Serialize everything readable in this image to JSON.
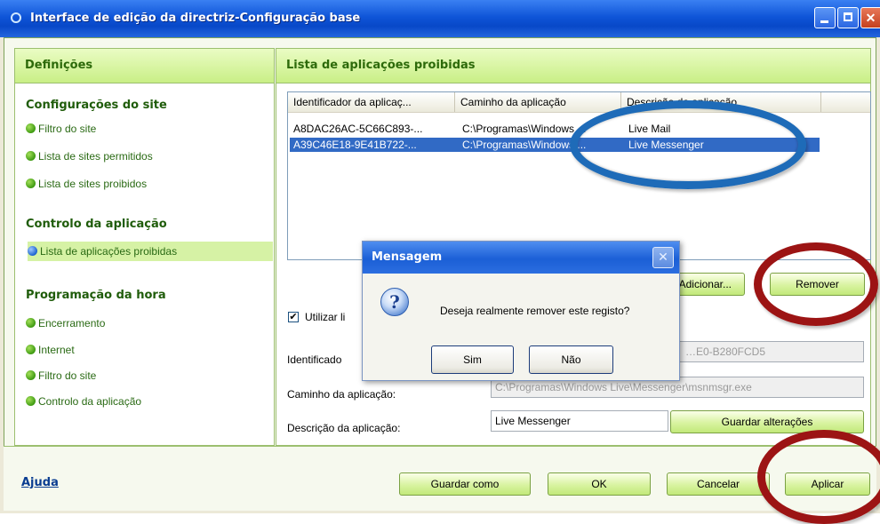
{
  "window": {
    "title": "Interface de edição da directriz-Configuração base"
  },
  "sidebar": {
    "header": "Definições",
    "groups": [
      {
        "title": "Configurações do site",
        "items": [
          "Filtro do site",
          "Lista de sites permitidos",
          "Lista de sites proibidos"
        ]
      },
      {
        "title": "Controlo da aplicação",
        "items": [
          "Lista de aplicações proibidas"
        ]
      },
      {
        "title": "Programação da hora",
        "items": [
          "Encerramento",
          "Internet",
          "Filtro do site",
          "Controlo da aplicação"
        ]
      }
    ],
    "active_item": "Lista de aplicações proibidas"
  },
  "main": {
    "header": "Lista de aplicações proibidas",
    "columns": [
      "Identificador da aplicaç...",
      "Caminho da aplicação",
      "Descrição da aplicação"
    ],
    "rows": [
      {
        "id": "A8DAC26AC-5C66C893-...",
        "path": "C:\\Programas\\Windows ...",
        "desc": "Live Mail",
        "selected": false
      },
      {
        "id": "A39C46E18-9E41B722-...",
        "path": "C:\\Programas\\Windows ...",
        "desc": "Live Messenger",
        "selected": true
      }
    ],
    "add_button": "Adicionar...",
    "remove_button": "Remover",
    "use_checkbox_label": "Utilizar li",
    "use_checkbox_checked": true,
    "id_label": "Identificado",
    "id_value": "…E0-B280FCD5",
    "path_label": "Caminho da aplicação:",
    "path_value": "C:\\Programas\\Windows Live\\Messenger\\msnmsgr.exe",
    "desc_label": "Descrição da aplicação:",
    "desc_value": "Live Messenger",
    "save_changes_button": "Guardar alterações"
  },
  "footer": {
    "help_link": "Ajuda",
    "save_as_button": "Guardar como",
    "ok_button": "OK",
    "cancel_button": "Cancelar",
    "apply_button": "Aplicar"
  },
  "dialog": {
    "title": "Mensagem",
    "message": "Deseja realmente remover este registo?",
    "icon": "question-icon",
    "yes_button": "Sim",
    "no_button": "Não"
  },
  "annotations": {
    "blue_ellipse_color": "#1e6bb8",
    "red_ellipse_color": "#9c1414"
  },
  "colors": {
    "titlebar": "#0f55d8",
    "accent_green": "#c9ef86",
    "selection": "#316ac5"
  }
}
